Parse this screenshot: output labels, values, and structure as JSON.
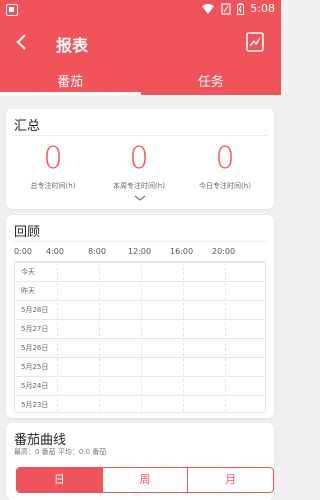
{
  "status_bar": {
    "time": "5:08"
  },
  "header": {
    "title": "报表"
  },
  "tabs": [
    {
      "label": "番茄",
      "active": true
    },
    {
      "label": "任务",
      "active": false
    }
  ],
  "summary": {
    "title": "汇总",
    "stats": [
      {
        "value": "0",
        "label": "总专注时间(h)"
      },
      {
        "value": "0",
        "label": "本周专注时间(h)"
      },
      {
        "value": "0",
        "label": "今日专注时间(h)"
      }
    ]
  },
  "review": {
    "title": "回顾",
    "times": [
      "0:00",
      "4:00",
      "8:00",
      "12:00",
      "16:00",
      "20:00"
    ],
    "rows": [
      "今天",
      "昨天",
      "5月28日",
      "5月27日",
      "5月26日",
      "5月25日",
      "5月24日",
      "5月23日"
    ]
  },
  "curve": {
    "title": "番茄曲线",
    "subtitle": "最高：0 番茄    平均：0.0 番茄",
    "segments": [
      "日",
      "周",
      "月"
    ]
  },
  "colors": {
    "accent": "#f0545a"
  }
}
